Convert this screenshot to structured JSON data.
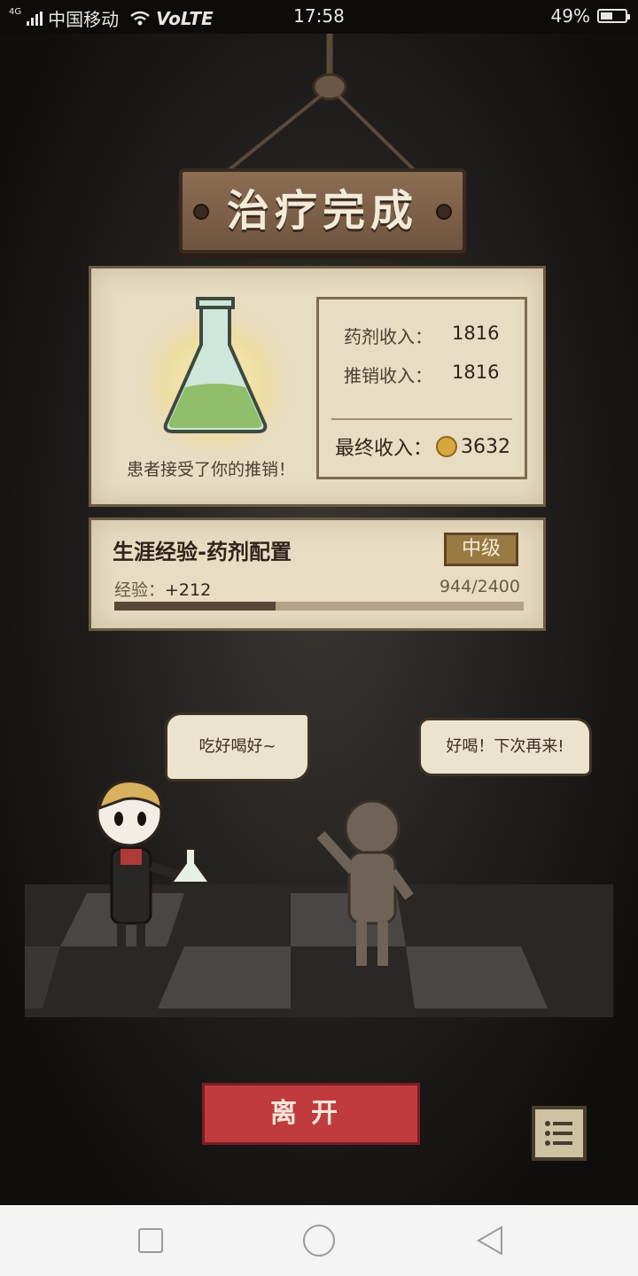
{
  "status_bar": {
    "network_type": "4G",
    "carrier": "中国移动",
    "volte": "VoLTE",
    "time": "17:58",
    "battery_percent": "49%",
    "battery_level": 0.49
  },
  "result_sign": {
    "title": "治疗完成"
  },
  "result_panel": {
    "patient_message": "患者接受了你的推销！",
    "potion_income_label": "药剂收入：",
    "potion_income_value": "1816",
    "promo_income_label": "推销收入：",
    "promo_income_value": "1816",
    "final_income_label": "最终收入：",
    "final_income_value": "3632"
  },
  "career_panel": {
    "title": "生涯经验-药剂配置",
    "level": "中级",
    "exp_label": "经验：",
    "exp_gain": "+212",
    "exp_progress": "944/2400",
    "exp_fraction": 0.393
  },
  "scene": {
    "doctor_speech": "吃好喝好~",
    "patient_speech": "好喝！下次再来!"
  },
  "buttons": {
    "leave": "离开"
  },
  "icons": {
    "signal": "signal-icon",
    "wifi": "wifi-icon",
    "battery": "battery-icon",
    "flask": "flask-icon",
    "coin": "coin-icon",
    "menu": "menu-icon",
    "nav_recent": "square-icon",
    "nav_home": "circle-icon",
    "nav_back": "back-triangle-icon"
  },
  "colors": {
    "parchment": "#e8dcc2",
    "wood": "#7a5e48",
    "leave_red": "#c03b3e",
    "level_gold": "#9a7a43"
  }
}
